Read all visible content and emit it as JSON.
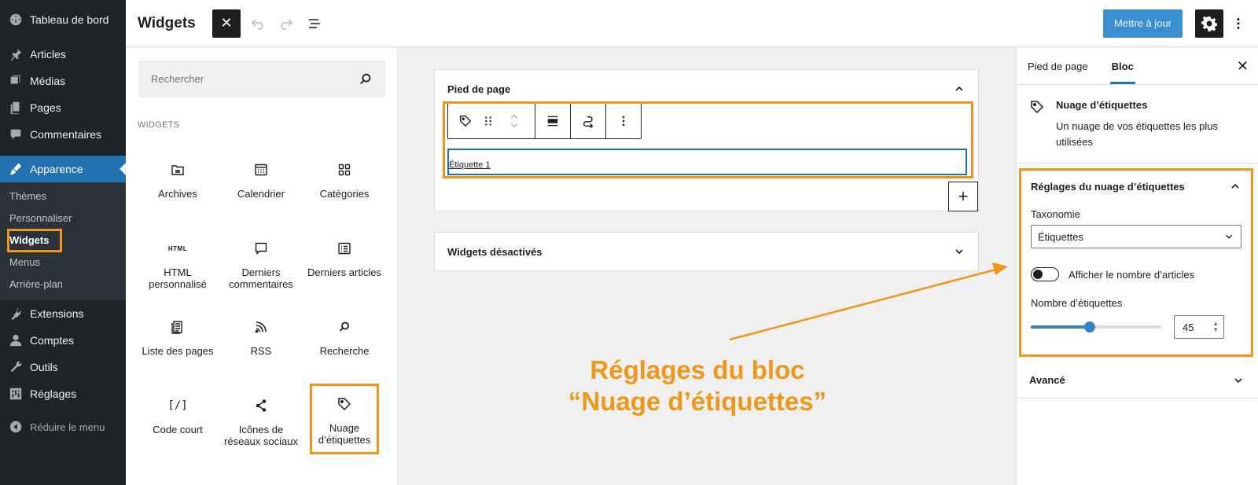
{
  "admin_menu": {
    "items_top": [
      {
        "label": "Tableau de bord",
        "icon": "dashboard-icon"
      },
      {
        "label": "Articles",
        "icon": "pin-icon"
      },
      {
        "label": "Médias",
        "icon": "media-icon"
      },
      {
        "label": "Pages",
        "icon": "pages-icon"
      },
      {
        "label": "Commentaires",
        "icon": "comments-icon"
      }
    ],
    "active": {
      "label": "Apparence",
      "icon": "brush-icon"
    },
    "submenu": [
      "Thèmes",
      "Personnaliser",
      "Widgets",
      "Menus",
      "Arrière-plan"
    ],
    "items_bottom": [
      {
        "label": "Extensions",
        "icon": "plugin-icon"
      },
      {
        "label": "Comptes",
        "icon": "user-icon"
      },
      {
        "label": "Outils",
        "icon": "wrench-icon"
      },
      {
        "label": "Réglages",
        "icon": "settings-icon"
      }
    ],
    "collapse_label": "Réduire le menu"
  },
  "header": {
    "title": "Widgets",
    "close": "✕",
    "update_button": "Mettre à jour"
  },
  "inserter": {
    "search_placeholder": "Rechercher",
    "section_title": "WIDGETS",
    "blocks": [
      {
        "label": "Archives",
        "icon": "archive-icon"
      },
      {
        "label": "Calendrier",
        "icon": "calendar-icon"
      },
      {
        "label": "Catégories",
        "icon": "categories-icon"
      },
      {
        "label": "HTML personnalisé",
        "icon": "html-icon",
        "icon_text": "HTML"
      },
      {
        "label": "Derniers commentaires",
        "icon": "comment-icon"
      },
      {
        "label": "Derniers articles",
        "icon": "post-list-icon"
      },
      {
        "label": "Liste des pages",
        "icon": "page-list-icon"
      },
      {
        "label": "RSS",
        "icon": "rss-icon"
      },
      {
        "label": "Recherche",
        "icon": "search-icon"
      },
      {
        "label": "Code court",
        "icon": "shortcode-icon",
        "icon_text": "[/]"
      },
      {
        "label": "Icônes de réseaux sociaux",
        "icon": "share-icon"
      },
      {
        "label": "Nuage d’étiquettes",
        "icon": "tag-icon"
      }
    ]
  },
  "canvas": {
    "footer_area_title": "Pied de page",
    "tag_link": "Étiquette 1",
    "add_symbol": "+",
    "inactive_area_title": "Widgets désactivés",
    "annotation_line1": "Réglages du bloc",
    "annotation_line2": "“Nuage d’étiquettes”"
  },
  "settings": {
    "tabs": [
      "Pied de page",
      "Bloc"
    ],
    "close": "✕",
    "block_title": "Nuage d’étiquettes",
    "block_description": "Un nuage de vos étiquettes les plus utilisées",
    "panel_title": "Réglages du nuage d’étiquettes",
    "taxonomy_label": "Taxonomie",
    "taxonomy_value": "Étiquettes",
    "toggle_label": "Afficher le nombre d’articles",
    "count_label": "Nombre d’étiquettes",
    "count_value": "45",
    "count_fraction": 0.45,
    "advanced_label": "Avancé"
  },
  "colors": {
    "accent": "#2271b1",
    "annotation": "#f0961b",
    "sidebar_bg": "#1d2327"
  }
}
